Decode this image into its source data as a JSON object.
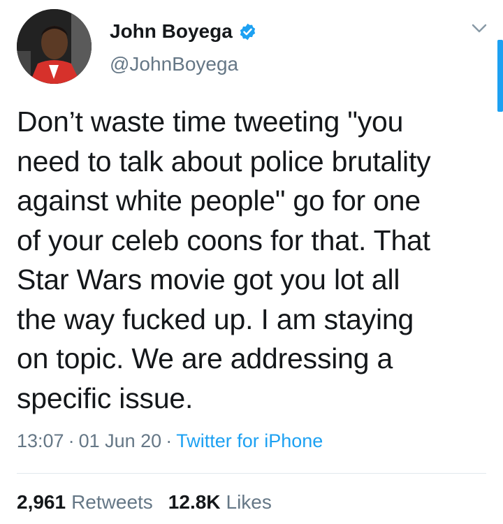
{
  "user": {
    "name": "John Boyega",
    "handle": "@JohnBoyega",
    "verified_icon": "verified-badge-icon",
    "avatar_icon": "profile-photo"
  },
  "tweet": {
    "text": "Don’t waste time tweeting \"you\nneed to talk about police brutality\nagainst white people\" go for one\nof your celeb coons for that. That\nStar Wars movie got you lot all\nthe way fucked up. I am staying\non topic. We are addressing a\nspecific issue.",
    "time": "13:07",
    "date": "01 Jun 20",
    "separator": "·",
    "source": "Twitter for iPhone"
  },
  "stats": {
    "retweets_count": "2,961",
    "retweets_label": "Retweets",
    "likes_count": "12.8K",
    "likes_label": "Likes"
  },
  "colors": {
    "accent": "#1da1f2",
    "secondary_text": "#657786",
    "primary_text": "#14171a",
    "divider": "#e1e8ed"
  }
}
